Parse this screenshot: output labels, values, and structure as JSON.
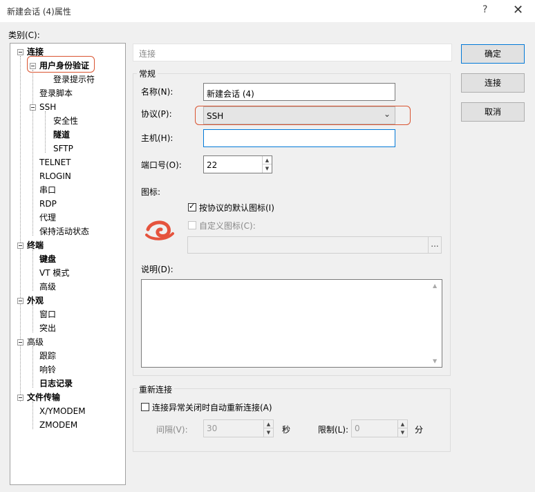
{
  "window": {
    "title": "新建会话 (4)属性",
    "help": "?",
    "close": "✕"
  },
  "category_label": "类别(C):",
  "tree": [
    {
      "label": "连接",
      "bold": true
    },
    {
      "label": "用户身份验证",
      "bold": true
    },
    {
      "label": "登录提示符",
      "bold": false
    },
    {
      "label": "登录脚本",
      "bold": false
    },
    {
      "label": "SSH",
      "bold": false
    },
    {
      "label": "安全性",
      "bold": false
    },
    {
      "label": "隧道",
      "bold": true
    },
    {
      "label": "SFTP",
      "bold": false
    },
    {
      "label": "TELNET",
      "bold": false
    },
    {
      "label": "RLOGIN",
      "bold": false
    },
    {
      "label": "串口",
      "bold": false
    },
    {
      "label": "RDP",
      "bold": false
    },
    {
      "label": "代理",
      "bold": false
    },
    {
      "label": "保持活动状态",
      "bold": false
    },
    {
      "label": "终端",
      "bold": true
    },
    {
      "label": "键盘",
      "bold": true
    },
    {
      "label": "VT 模式",
      "bold": false
    },
    {
      "label": "高级",
      "bold": false
    },
    {
      "label": "外观",
      "bold": true
    },
    {
      "label": "窗口",
      "bold": false
    },
    {
      "label": "突出",
      "bold": false
    },
    {
      "label": "高级",
      "bold": false
    },
    {
      "label": "跟踪",
      "bold": false
    },
    {
      "label": "响铃",
      "bold": false
    },
    {
      "label": "日志记录",
      "bold": true
    },
    {
      "label": "文件传输",
      "bold": true
    },
    {
      "label": "X/YMODEM",
      "bold": false
    },
    {
      "label": "ZMODEM",
      "bold": false
    }
  ],
  "panel_title": "连接",
  "general": {
    "group_label": "常规",
    "name_label": "名称(N):",
    "name_value": "新建会话 (4)",
    "protocol_label": "协议(P):",
    "protocol_value": "SSH",
    "host_label": "主机(H):",
    "host_value": "",
    "port_label": "端口号(O):",
    "port_value": "22",
    "icon_label": "图标:",
    "default_icon_label": "按协议的默认图标(I)",
    "default_icon_checked": true,
    "custom_icon_label": "自定义图标(C):",
    "custom_icon_checked": false,
    "browse_label": "...",
    "desc_label": "说明(D):",
    "desc_value": ""
  },
  "reconnect": {
    "group_label": "重新连接",
    "auto_label": "连接异常关闭时自动重新连接(A)",
    "auto_checked": false,
    "interval_label": "间隔(V):",
    "interval_value": "30",
    "seconds_unit": "秒",
    "limit_label": "限制(L):",
    "limit_value": "0",
    "minutes_unit": "分"
  },
  "buttons": {
    "ok": "确定",
    "connect": "连接",
    "cancel": "取消"
  },
  "colors": {
    "highlight": "#d9532f",
    "icon": "#e5533d",
    "focus": "#0078d7"
  }
}
